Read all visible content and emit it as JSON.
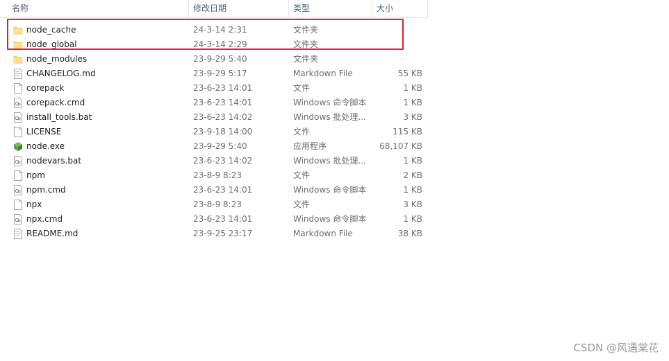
{
  "columns": {
    "name": "名称",
    "date": "修改日期",
    "type": "类型",
    "size": "大小"
  },
  "sort_indicator": "^",
  "files": [
    {
      "name": "node_cache",
      "date": "24-3-14 2:31",
      "type": "文件夹",
      "size": "",
      "icon": "folder-icon"
    },
    {
      "name": "node_global",
      "date": "24-3-14 2:29",
      "type": "文件夹",
      "size": "",
      "icon": "folder-icon"
    },
    {
      "name": "node_modules",
      "date": "23-9-29 5:40",
      "type": "文件夹",
      "size": "",
      "icon": "folder-icon"
    },
    {
      "name": "CHANGELOG.md",
      "date": "23-9-29 5:17",
      "type": "Markdown File",
      "size": "55 KB",
      "icon": "markdown-file-icon"
    },
    {
      "name": "corepack",
      "date": "23-6-23 14:01",
      "type": "文件",
      "size": "1 KB",
      "icon": "file-icon"
    },
    {
      "name": "corepack.cmd",
      "date": "23-6-23 14:01",
      "type": "Windows 命令脚本",
      "size": "1 KB",
      "icon": "script-file-icon"
    },
    {
      "name": "install_tools.bat",
      "date": "23-6-23 14:02",
      "type": "Windows 批处理...",
      "size": "3 KB",
      "icon": "script-file-icon"
    },
    {
      "name": "LICENSE",
      "date": "23-9-18 14:00",
      "type": "文件",
      "size": "115 KB",
      "icon": "file-icon"
    },
    {
      "name": "node.exe",
      "date": "23-9-29 5:40",
      "type": "应用程序",
      "size": "68,107 KB",
      "icon": "node-exe-icon"
    },
    {
      "name": "nodevars.bat",
      "date": "23-6-23 14:02",
      "type": "Windows 批处理...",
      "size": "1 KB",
      "icon": "script-file-icon"
    },
    {
      "name": "npm",
      "date": "23-8-9 8:23",
      "type": "文件",
      "size": "2 KB",
      "icon": "file-icon"
    },
    {
      "name": "npm.cmd",
      "date": "23-6-23 14:01",
      "type": "Windows 命令脚本",
      "size": "1 KB",
      "icon": "script-file-icon"
    },
    {
      "name": "npx",
      "date": "23-8-9 8:23",
      "type": "文件",
      "size": "3 KB",
      "icon": "file-icon"
    },
    {
      "name": "npx.cmd",
      "date": "23-6-23 14:01",
      "type": "Windows 命令脚本",
      "size": "1 KB",
      "icon": "script-file-icon"
    },
    {
      "name": "README.md",
      "date": "23-9-25 23:17",
      "type": "Markdown File",
      "size": "38 KB",
      "icon": "markdown-file-icon"
    }
  ],
  "highlight_color": "#d9242f",
  "folder_color": "#f8d775",
  "watermark": "CSDN @风遇棠花"
}
